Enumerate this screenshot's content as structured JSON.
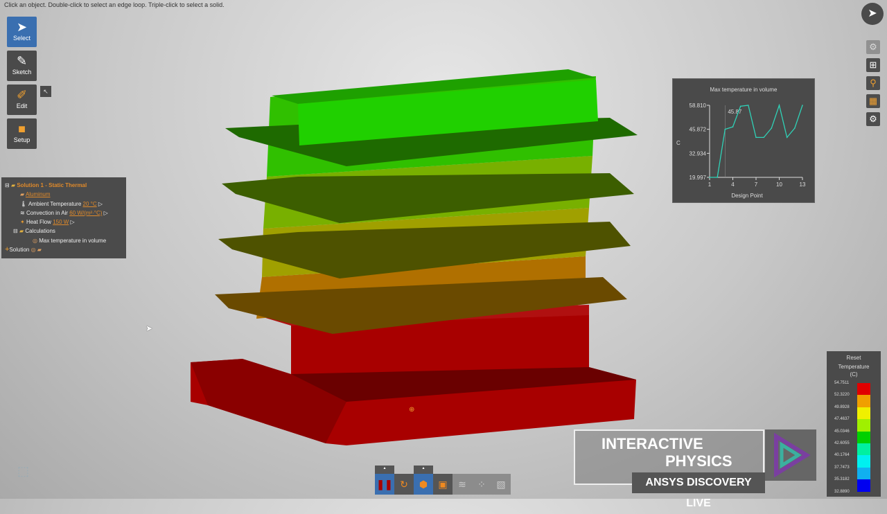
{
  "hint": "Click an object. Double-click to select an edge loop. Triple-click to select a solid.",
  "tools": [
    {
      "label": "Select",
      "icon": "cursor-icon"
    },
    {
      "label": "Sketch",
      "icon": "pencil-icon"
    },
    {
      "label": "Edit",
      "icon": "edit-icon"
    },
    {
      "label": "Setup",
      "icon": "setup-icon"
    }
  ],
  "tree": {
    "title": "Solution 1 - Static Thermal",
    "material": "Aluminum",
    "ambient_label": "Ambient Temperature",
    "ambient_value": "20 °C",
    "convection_label": "Convection in Air",
    "convection_value": "60 W/(m²·°C)",
    "heat_label": "Heat Flow",
    "heat_value": "150 W",
    "calc_label": "Calculations",
    "calc_item": "Max temperature in volume",
    "add_solution": "Solution"
  },
  "chart_data": {
    "type": "line",
    "title": "Max temperature in volume",
    "xlabel": "Design Point",
    "ylabel": "C",
    "x": [
      1,
      2,
      3,
      4,
      5,
      6,
      7,
      8,
      9,
      10,
      11,
      12,
      13
    ],
    "values": [
      19.997,
      19.997,
      45.87,
      47.2,
      58.3,
      58.81,
      41.5,
      41.5,
      46.5,
      58.81,
      41.5,
      46.5,
      58.81
    ],
    "yticks": [
      "19.997",
      "32.934",
      "45.872",
      "58.810"
    ],
    "xticks": [
      "1",
      "4",
      "7",
      "10",
      "13"
    ],
    "ylim": [
      19.997,
      58.81
    ],
    "xlim": [
      1,
      13
    ],
    "marker_x": 3,
    "marker_label": "45.87",
    "color": "#2fd3b8"
  },
  "legend": {
    "reset": "Reset",
    "title": "Temperature",
    "unit": "(C)",
    "labels": [
      "54.7511",
      "52.3220",
      "49.8928",
      "47.4637",
      "45.0346",
      "42.6055",
      "40.1764",
      "37.7473",
      "35.3182",
      "32.8890"
    ],
    "colors": [
      "#e00000",
      "#f0a000",
      "#f0f000",
      "#a0f000",
      "#00d000",
      "#00f0a0",
      "#00f0f0",
      "#10b0f0",
      "#0000f0"
    ]
  },
  "brand": {
    "line1": "INTERACTIVE",
    "line2": "PHYSICS",
    "line3": "ANSYS DISCOVERY LIVE"
  }
}
